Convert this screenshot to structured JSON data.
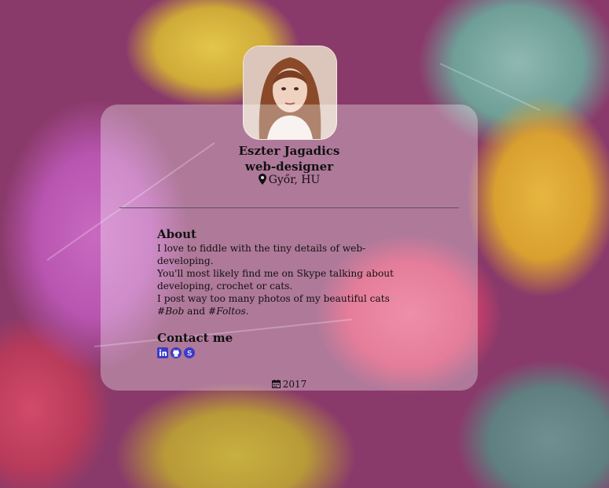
{
  "profile": {
    "name": "Eszter Jagadics",
    "role": "web-designer",
    "location": "Győr, HU"
  },
  "about": {
    "title": "About",
    "line1": "I love to fiddle with the tiny details of web-developing.",
    "line2": "You'll most likely find me on Skype talking about developing, crochet or cats.",
    "line3_prefix": "I post way too many photos of my beautiful cats ",
    "cat1": "#Bob",
    "and": " and ",
    "cat2": "#Foltos",
    "period": "."
  },
  "contact": {
    "title": "Contact me",
    "icons": [
      "linkedin-icon",
      "github-icon",
      "skype-icon"
    ],
    "icon_color": "#3b3bc8"
  },
  "footer": {
    "year": "2017"
  }
}
